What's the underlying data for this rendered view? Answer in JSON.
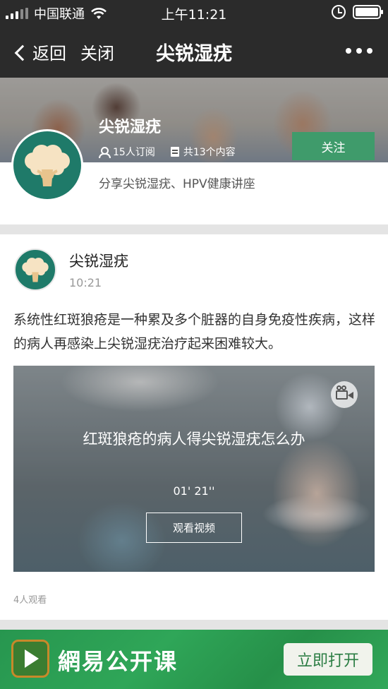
{
  "status_bar": {
    "carrier": "中国联通",
    "time": "上午11:21"
  },
  "nav": {
    "back_label": "返回",
    "close_label": "关闭",
    "title": "尖锐湿疣"
  },
  "channel": {
    "name": "尖锐湿疣",
    "subscribers": "15人订阅",
    "content_count": "共13个内容",
    "follow_label": "关注",
    "description": "分享尖锐湿疣、HPV健康讲座"
  },
  "post": {
    "author": "尖锐湿疣",
    "time": "10:21",
    "text": "系统性红斑狼疮是一种累及多个脏器的自身免疫性疾病，这样的病人再感染上尖锐湿疣治疗起来困难较大。",
    "video": {
      "title": "红斑狼疮的病人得尖锐湿疣怎么办",
      "duration": "01' 21''",
      "watch_label": "观看视频"
    },
    "views": "4人观看"
  },
  "app_banner": {
    "name": "網易公开课",
    "open_label": "立即打开"
  },
  "colors": {
    "bar_bg": "#2b2b2b",
    "accent_green": "#3f9b6b",
    "avatar_teal": "#1f7a69",
    "banner_green": "#2fa658"
  }
}
